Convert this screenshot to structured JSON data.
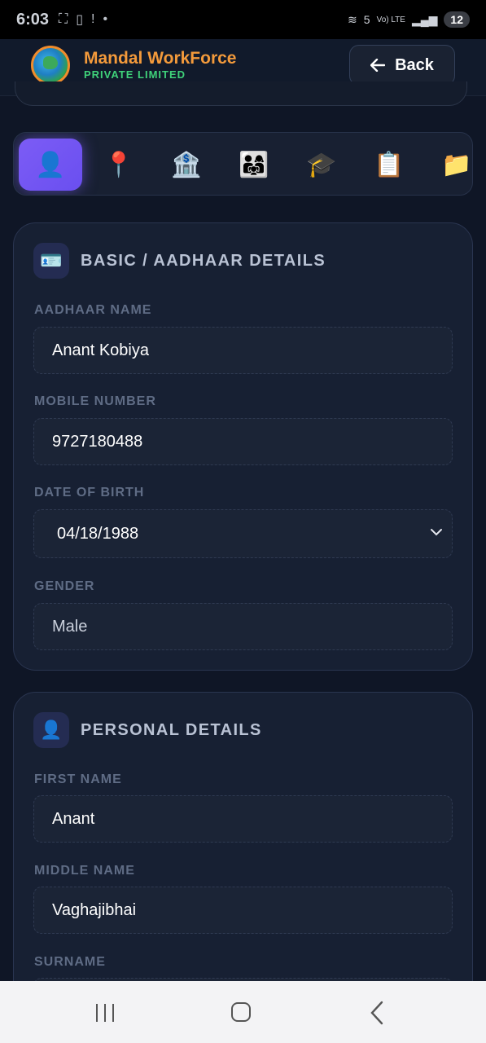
{
  "status_bar": {
    "time": "6:03",
    "network": "5",
    "volte": "Vo) LTE",
    "battery": "12"
  },
  "header": {
    "brand_name": "Mandal WorkForce",
    "brand_sub": "PRIVATE LIMITED",
    "back_label": "Back"
  },
  "tabs": [
    {
      "icon": "👤",
      "name": "basic",
      "active": true
    },
    {
      "icon": "📍",
      "name": "address",
      "active": false
    },
    {
      "icon": "🏦",
      "name": "bank",
      "active": false
    },
    {
      "icon": "👨‍👩‍👧",
      "name": "family",
      "active": false
    },
    {
      "icon": "🎓",
      "name": "education",
      "active": false
    },
    {
      "icon": "📋",
      "name": "documents-list",
      "active": false
    },
    {
      "icon": "📁",
      "name": "files",
      "active": false
    }
  ],
  "basic_details": {
    "icon": "🪪",
    "title": "BASIC / AADHAAR DETAILS",
    "aadhaar_name_label": "AADHAAR NAME",
    "aadhaar_name_value": "Anant Kobiya",
    "mobile_label": "MOBILE NUMBER",
    "mobile_value": "9727180488",
    "dob_label": "DATE OF BIRTH",
    "dob_value": "04/18/1988",
    "gender_label": "GENDER",
    "gender_value": "Male"
  },
  "personal_details": {
    "icon": "👤",
    "title": "PERSONAL DETAILS",
    "first_name_label": "FIRST NAME",
    "first_name_value": "Anant",
    "middle_name_label": "MIDDLE NAME",
    "middle_name_value": "Vaghajibhai",
    "surname_label": "SURNAME"
  },
  "colors": {
    "accent": "#7c5cf5",
    "brand_orange": "#f39a3b",
    "brand_green": "#3fd27a",
    "background": "#0f1626"
  }
}
